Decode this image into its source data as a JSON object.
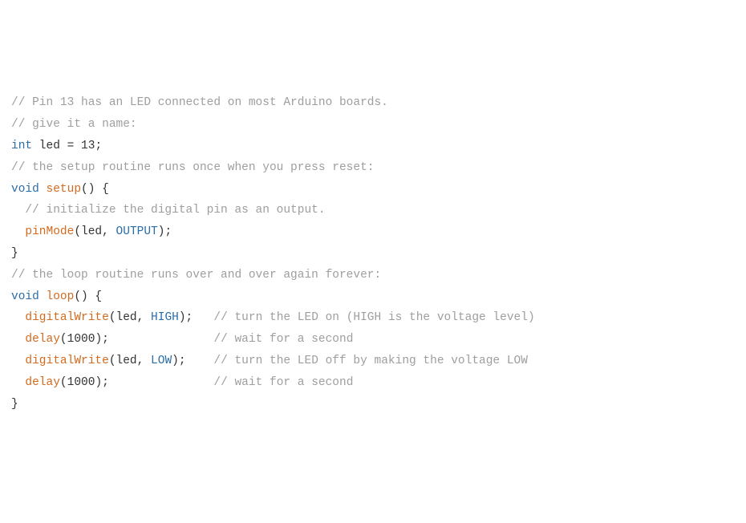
{
  "code": {
    "l1": "// Pin 13 has an LED connected on most Arduino boards.",
    "l2": "// give it a name:",
    "l3_kw": "int",
    "l3_id": " led ",
    "l3_eq": "= ",
    "l3_num": "13",
    "l3_semi": ";",
    "l4": "",
    "l5": "// the setup routine runs once when you press reset:",
    "l6_void": "void",
    "l6_sp": " ",
    "l6_fn": "setup",
    "l6_paren": "() {",
    "l7": "  // initialize the digital pin as an output.",
    "l8_indent": "  ",
    "l8_fn": "pinMode",
    "l8_open": "(",
    "l8_arg1": "led",
    "l8_comma": ", ",
    "l8_const": "OUTPUT",
    "l8_close": ");",
    "l9": "}",
    "l10": "",
    "l11": "// the loop routine runs over and over again forever:",
    "l12_void": "void",
    "l12_sp": " ",
    "l12_fn": "loop",
    "l12_paren": "() {",
    "l13_indent": "  ",
    "l13_fn": "digitalWrite",
    "l13_open": "(",
    "l13_arg1": "led",
    "l13_comma": ", ",
    "l13_const": "HIGH",
    "l13_close": ");   ",
    "l13_comment": "// turn the LED on (HIGH is the voltage level)",
    "l14_indent": "  ",
    "l14_fn": "delay",
    "l14_open": "(",
    "l14_num": "1000",
    "l14_close": ");               ",
    "l14_comment": "// wait for a second",
    "l15_indent": "  ",
    "l15_fn": "digitalWrite",
    "l15_open": "(",
    "l15_arg1": "led",
    "l15_comma": ", ",
    "l15_const": "LOW",
    "l15_close": ");    ",
    "l15_comment": "// turn the LED off by making the voltage LOW",
    "l16_indent": "  ",
    "l16_fn": "delay",
    "l16_open": "(",
    "l16_num": "1000",
    "l16_close": ");               ",
    "l16_comment": "// wait for a second",
    "l17": "}"
  }
}
